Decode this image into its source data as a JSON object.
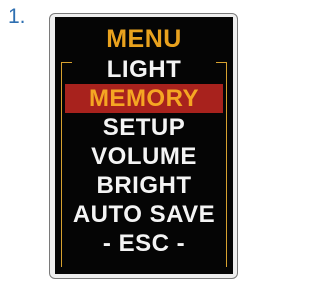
{
  "step": {
    "number": "1."
  },
  "menu": {
    "title": "MENU",
    "items": [
      {
        "label": "LIGHT",
        "selected": false
      },
      {
        "label": "MEMORY",
        "selected": true
      },
      {
        "label": "SETUP",
        "selected": false
      },
      {
        "label": "VOLUME",
        "selected": false
      },
      {
        "label": "BRIGHT",
        "selected": false
      },
      {
        "label": "AUTO SAVE",
        "selected": false
      },
      {
        "label": "- ESC -",
        "selected": false
      }
    ]
  },
  "colors": {
    "title_text": "#e9a21e",
    "item_text": "#f4f4f4",
    "selected_background": "#a8221d",
    "selected_text": "#f5a623",
    "screen_background": "#050505",
    "bracket": "#d7a12f",
    "step_number": "#2e6fb1"
  }
}
